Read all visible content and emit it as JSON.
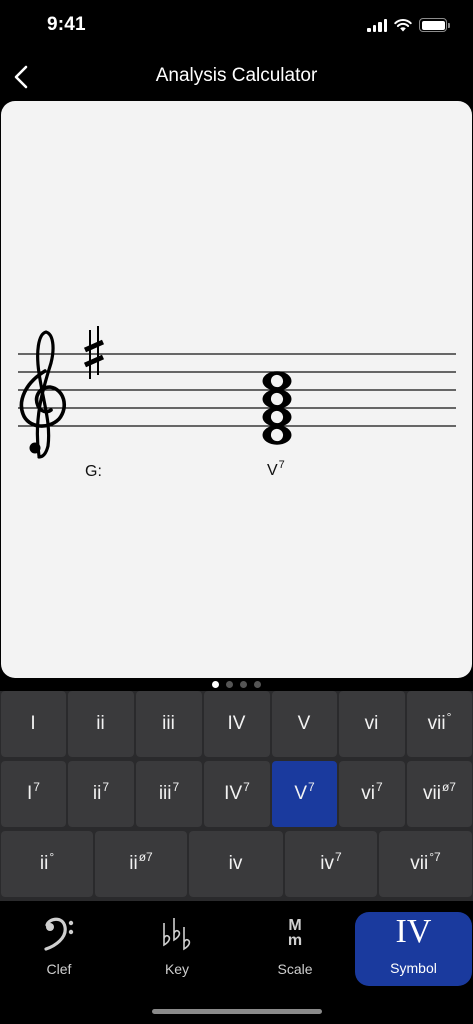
{
  "status_bar": {
    "time": "9:41"
  },
  "nav": {
    "title": "Analysis Calculator",
    "back_icon": "chevron-left-icon"
  },
  "score": {
    "clef": "treble",
    "key_signature": "1 sharp (F#)",
    "key_label": "G:",
    "chord_label_base": "V",
    "chord_label_sup": "7"
  },
  "page_indicator": {
    "pages": 4,
    "current": 1
  },
  "keypad": {
    "rows": [
      [
        {
          "base": "I",
          "sup": ""
        },
        {
          "base": "ii",
          "sup": ""
        },
        {
          "base": "iii",
          "sup": ""
        },
        {
          "base": "IV",
          "sup": ""
        },
        {
          "base": "V",
          "sup": ""
        },
        {
          "base": "vi",
          "sup": ""
        },
        {
          "base": "vii",
          "sup": "°"
        }
      ],
      [
        {
          "base": "I",
          "sup": "7"
        },
        {
          "base": "ii",
          "sup": "7"
        },
        {
          "base": "iii",
          "sup": "7"
        },
        {
          "base": "IV",
          "sup": "7"
        },
        {
          "base": "V",
          "sup": "7"
        },
        {
          "base": "vi",
          "sup": "7"
        },
        {
          "base": "vii",
          "sup": "ø7"
        }
      ],
      [
        {
          "base": "ii",
          "sup": "°"
        },
        {
          "base": "ii",
          "sup": "ø7"
        },
        {
          "base": "iv",
          "sup": ""
        },
        {
          "base": "iv",
          "sup": "7"
        },
        {
          "base": "vii",
          "sup": "°7"
        }
      ]
    ],
    "selected": "V7",
    "selected_color": "#1a3a9e"
  },
  "tabs": [
    {
      "label": "Clef",
      "icon": "bass-clef-icon"
    },
    {
      "label": "Key",
      "icon": "flats-icon",
      "glyph": "♭♭♭"
    },
    {
      "label": "Scale",
      "icon": "major-minor-icon",
      "glyph_top": "M",
      "glyph_bottom": "m"
    },
    {
      "label": "Symbol",
      "icon": "roman-numeral-icon",
      "glyph": "IV",
      "active": true
    }
  ]
}
